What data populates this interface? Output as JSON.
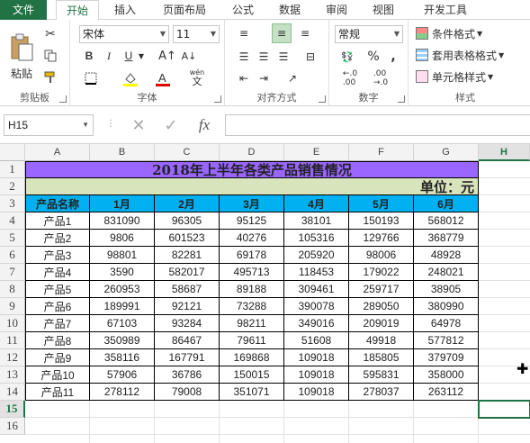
{
  "tabs": [
    "文件",
    "开始",
    "插入",
    "页面布局",
    "公式",
    "数据",
    "审阅",
    "视图",
    "开发工具"
  ],
  "ribbon": {
    "clipboard": {
      "paste": "粘贴",
      "label": "剪贴板"
    },
    "font": {
      "name": "宋体",
      "size": "11",
      "bold": "B",
      "italic": "I",
      "underline": "U",
      "label": "字体",
      "wen": "wén",
      "wen_char": "文"
    },
    "alignment": {
      "label": "对齐方式"
    },
    "number": {
      "format": "常规",
      "percent": "%",
      "comma": ",",
      "label": "数字"
    },
    "styles": {
      "conditional": "条件格式",
      "table": "套用表格格式",
      "cell": "单元格样式",
      "label": "样式"
    }
  },
  "formula_bar": {
    "cell_ref": "H15",
    "fx": "fx",
    "formula": ""
  },
  "sheet": {
    "columns": [
      "A",
      "B",
      "C",
      "D",
      "E",
      "F",
      "G",
      "H"
    ],
    "rows": [
      "1",
      "2",
      "3",
      "4",
      "5",
      "6",
      "7",
      "8",
      "9",
      "10",
      "11",
      "12",
      "13",
      "14",
      "15",
      "16"
    ],
    "title": "2018年上半年各类产品销售情况",
    "unit": "单位：元",
    "headers": [
      "产品名称",
      "1月",
      "2月",
      "3月",
      "4月",
      "5月",
      "6月"
    ],
    "data": [
      [
        "产品1",
        "831090",
        "96305",
        "95125",
        "38101",
        "150193",
        "568012"
      ],
      [
        "产品2",
        "9806",
        "601523",
        "40276",
        "105316",
        "129766",
        "368779"
      ],
      [
        "产品3",
        "98801",
        "82281",
        "69178",
        "205920",
        "98006",
        "48928"
      ],
      [
        "产品4",
        "3590",
        "582017",
        "495713",
        "118453",
        "179022",
        "248021"
      ],
      [
        "产品5",
        "260953",
        "58687",
        "89188",
        "309461",
        "259717",
        "38905"
      ],
      [
        "产品6",
        "189991",
        "92121",
        "73288",
        "390078",
        "289050",
        "380990"
      ],
      [
        "产品7",
        "67103",
        "93284",
        "98211",
        "349016",
        "209019",
        "64978"
      ],
      [
        "产品8",
        "350989",
        "86467",
        "79611",
        "51608",
        "49918",
        "577812"
      ],
      [
        "产品9",
        "358116",
        "167791",
        "169868",
        "109018",
        "185805",
        "379709"
      ],
      [
        "产品10",
        "57906",
        "36786",
        "150015",
        "109018",
        "595831",
        "358000"
      ],
      [
        "产品11",
        "278112",
        "79008",
        "351071",
        "109018",
        "278037",
        "263112"
      ]
    ],
    "colors": {
      "title_bg": "#9966ff",
      "unit_bg": "#d8e4bc",
      "header_bg": "#00b0f0",
      "accent": "#217346"
    }
  }
}
